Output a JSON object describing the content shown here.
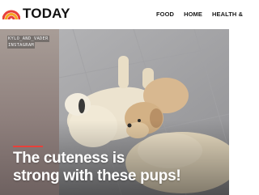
{
  "header": {
    "logo_text": "TODAY",
    "nav": [
      "FOOD",
      "HOME",
      "HEALTH &"
    ]
  },
  "hero": {
    "credit_lines": [
      "KYLO_AND_VADER",
      "INSTAGRAM"
    ],
    "headline_lines": [
      "The cuteness is",
      "strong with these pups!"
    ]
  },
  "colors": {
    "accent": "#e8403a",
    "logo_orange": "#f5a623",
    "logo_red": "#e8403a"
  },
  "icons": {
    "logo": "rainbow-logo-icon"
  }
}
